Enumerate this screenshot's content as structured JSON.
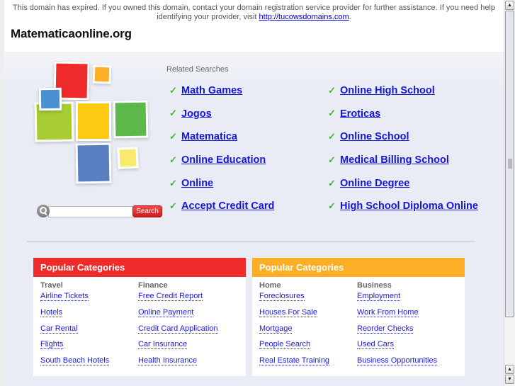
{
  "header": {
    "notice_text": "This domain has expired. If you owned this domain, contact your domain registration service provider for further assistance. If you need help identifying your provider, visit ",
    "notice_link": "http://tucowsdomains.com",
    "notice_end": ".",
    "site_title": "Matematicaonline.org"
  },
  "logo": {
    "icon": "colored-squares-logo"
  },
  "search": {
    "icon": "magnifier-icon",
    "value": "",
    "placeholder": "",
    "button_label": "Search"
  },
  "related": {
    "label": "Related Searches",
    "check_icon": "✓",
    "left": [
      "Math Games",
      "Jogos",
      "Matematica",
      "Online Education",
      "Online",
      "Accept Credit Card"
    ],
    "right": [
      "Online High School",
      "Eroticas",
      "Online School",
      "Medical Billing School",
      "Online Degree",
      "High School Diploma Online"
    ]
  },
  "categories": [
    {
      "title": "Popular Categories",
      "color": "#ee2a2a",
      "columns": [
        {
          "title": "Travel",
          "links": [
            "Airline Tickets",
            "Hotels",
            "Car Rental",
            "Flights",
            "South Beach Hotels"
          ]
        },
        {
          "title": "Finance",
          "links": [
            "Free Credit Report",
            "Online Payment",
            "Credit Card Application",
            "Car Insurance",
            "Health Insurance"
          ]
        }
      ]
    },
    {
      "title": "Popular Categories",
      "color": "#fbae26",
      "columns": [
        {
          "title": "Home",
          "links": [
            "Foreclosures",
            "Houses For Sale",
            "Mortgage",
            "People Search",
            "Real Estate Training"
          ]
        },
        {
          "title": "Business",
          "links": [
            "Employment",
            "Work From Home",
            "Reorder Checks",
            "Used Cars",
            "Business Opportunities"
          ]
        }
      ]
    }
  ],
  "scrollbar": {
    "up_icon": "▲",
    "down_icon": "▼"
  }
}
